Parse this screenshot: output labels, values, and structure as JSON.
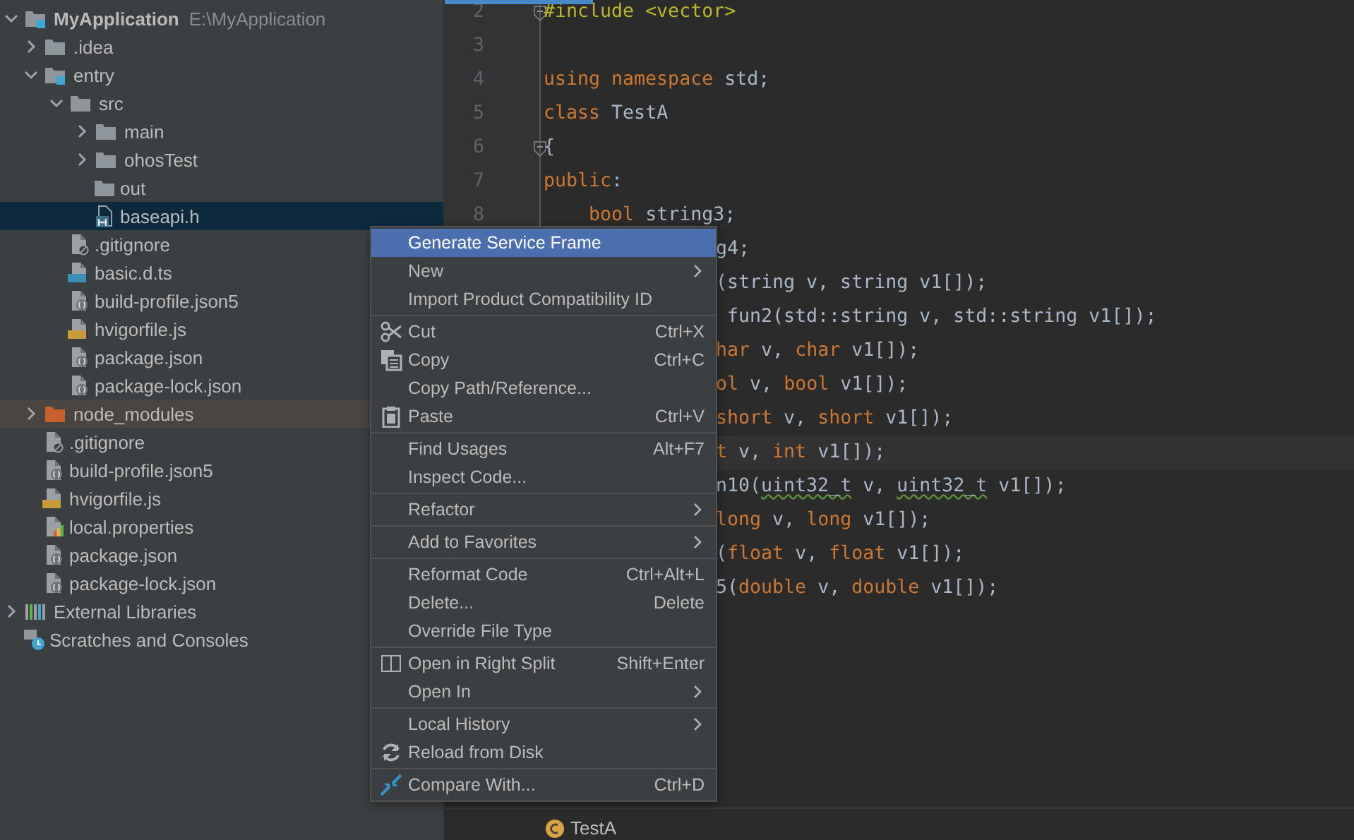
{
  "project_tree": [
    {
      "label": "MyApplication",
      "path": "E:\\MyApplication",
      "kind": "module-folder",
      "expanded": true,
      "selected": false,
      "children": [
        {
          "label": ".idea",
          "kind": "folder",
          "expanded": false,
          "selected": false
        },
        {
          "label": "entry",
          "kind": "module-folder",
          "expanded": true,
          "selected": false,
          "children": [
            {
              "label": "src",
              "kind": "folder",
              "expanded": true,
              "selected": false,
              "children": [
                {
                  "label": "main",
                  "kind": "folder",
                  "expanded": false,
                  "selected": false
                },
                {
                  "label": "ohosTest",
                  "kind": "folder",
                  "expanded": false,
                  "selected": false
                },
                {
                  "label": "out",
                  "kind": "folder",
                  "selected": false
                },
                {
                  "label": "baseapi.h",
                  "kind": "header",
                  "selected": true
                }
              ]
            },
            {
              "label": ".gitignore",
              "kind": "ignore",
              "selected": false
            },
            {
              "label": "basic.d.ts",
              "kind": "ts",
              "selected": false
            },
            {
              "label": "build-profile.json5",
              "kind": "json",
              "selected": false
            },
            {
              "label": "hvigorfile.js",
              "kind": "js",
              "selected": false
            },
            {
              "label": "package.json",
              "kind": "json",
              "selected": false
            },
            {
              "label": "package-lock.json",
              "kind": "json",
              "selected": false
            }
          ]
        },
        {
          "label": "node_modules",
          "kind": "excluded-folder",
          "expanded": false,
          "selected": false
        },
        {
          "label": ".gitignore",
          "kind": "ignore",
          "selected": false
        },
        {
          "label": "build-profile.json5",
          "kind": "json",
          "selected": false
        },
        {
          "label": "hvigorfile.js",
          "kind": "js",
          "selected": false
        },
        {
          "label": "local.properties",
          "kind": "properties",
          "selected": false
        },
        {
          "label": "package.json",
          "kind": "json",
          "selected": false
        },
        {
          "label": "package-lock.json",
          "kind": "json",
          "selected": false
        }
      ]
    },
    {
      "label": "External Libraries",
      "kind": "libraries",
      "expanded": false,
      "selected": false
    },
    {
      "label": "Scratches and Consoles",
      "kind": "scratches",
      "selected": false
    }
  ],
  "editor": {
    "lines": [
      {
        "number": "2",
        "kind": "full",
        "fold": true,
        "tokens": [
          {
            "text": "#include <vector>",
            "kind": "macro"
          }
        ]
      },
      {
        "number": "3",
        "kind": "full"
      },
      {
        "number": "4",
        "kind": "full",
        "tokens": [
          {
            "text": "using namespace ",
            "kind": "keyword"
          },
          {
            "text": "std;",
            "kind": "plain"
          }
        ]
      },
      {
        "number": "5",
        "kind": "full",
        "tokens": [
          {
            "text": "class ",
            "kind": "keyword"
          },
          {
            "text": "TestA",
            "kind": "plain"
          }
        ]
      },
      {
        "number": "6",
        "kind": "full",
        "fold": true,
        "tokens": [
          {
            "text": "{",
            "kind": "plain"
          }
        ]
      },
      {
        "number": "7",
        "kind": "full",
        "tokens": [
          {
            "text": "public",
            "kind": "keyword"
          },
          {
            "text": ":",
            "kind": "plain"
          }
        ]
      },
      {
        "number": "8",
        "kind": "full",
        "tokens": [
          {
            "text": "    bool ",
            "kind": "keyword"
          },
          {
            "text": "string3;",
            "kind": "plain"
          }
        ]
      },
      {
        "kind": "partial",
        "tokens": [
          {
            "text": "g4;",
            "kind": "plain"
          }
        ]
      },
      {
        "kind": "partial",
        "tokens": [
          {
            "text": "(string v, string v1[]);",
            "kind": "plain"
          }
        ]
      },
      {
        "kind": "partial",
        "tokens": [
          {
            "text": " fun2(std::string v, std::string v1[]);",
            "kind": "plain"
          }
        ]
      },
      {
        "kind": "partial",
        "tokens": [
          {
            "text": "har ",
            "kind": "keyword"
          },
          {
            "text": "v, ",
            "kind": "plain"
          },
          {
            "text": "char ",
            "kind": "keyword"
          },
          {
            "text": "v1[]);",
            "kind": "plain"
          }
        ]
      },
      {
        "kind": "partial",
        "tokens": [
          {
            "text": "ol ",
            "kind": "keyword"
          },
          {
            "text": "v, ",
            "kind": "plain"
          },
          {
            "text": "bool ",
            "kind": "keyword"
          },
          {
            "text": "v1[]);",
            "kind": "plain"
          }
        ]
      },
      {
        "kind": "partial",
        "tokens": [
          {
            "text": "short ",
            "kind": "keyword"
          },
          {
            "text": "v, ",
            "kind": "plain"
          },
          {
            "text": "short ",
            "kind": "keyword"
          },
          {
            "text": "v1[]);",
            "kind": "plain"
          }
        ]
      },
      {
        "kind": "partial",
        "current": true,
        "tokens": [
          {
            "text": "t ",
            "kind": "keyword"
          },
          {
            "text": "v, ",
            "kind": "plain"
          },
          {
            "text": "int ",
            "kind": "keyword"
          },
          {
            "text": "v1[]);",
            "kind": "plain"
          }
        ]
      },
      {
        "kind": "partial",
        "tokens": [
          {
            "text": "n10(",
            "kind": "plain"
          },
          {
            "text": "uint32_t",
            "kind": "warning"
          },
          {
            "text": " v, ",
            "kind": "plain"
          },
          {
            "text": "uint32_t",
            "kind": "warning"
          },
          {
            "text": " v1[]);",
            "kind": "plain"
          }
        ]
      },
      {
        "kind": "partial",
        "tokens": [
          {
            "text": "long ",
            "kind": "keyword"
          },
          {
            "text": "v, ",
            "kind": "plain"
          },
          {
            "text": "long ",
            "kind": "keyword"
          },
          {
            "text": "v1[]);",
            "kind": "plain"
          }
        ]
      },
      {
        "kind": "partial",
        "tokens": [
          {
            "text": "(",
            "kind": "plain"
          },
          {
            "text": "float ",
            "kind": "keyword"
          },
          {
            "text": "v, ",
            "kind": "plain"
          },
          {
            "text": "float ",
            "kind": "keyword"
          },
          {
            "text": "v1[]);",
            "kind": "plain"
          }
        ]
      },
      {
        "kind": "partial",
        "tokens": [
          {
            "text": "5(",
            "kind": "plain"
          },
          {
            "text": "double ",
            "kind": "keyword"
          },
          {
            "text": "v, ",
            "kind": "plain"
          },
          {
            "text": "double ",
            "kind": "keyword"
          },
          {
            "text": "v1[]);",
            "kind": "plain"
          }
        ]
      }
    ],
    "breadcrumb": "TestA"
  },
  "context_menu": [
    {
      "kind": "item",
      "label": "Generate Service Frame",
      "selected": true
    },
    {
      "kind": "item",
      "label": "New",
      "submenu": true,
      "selected": false
    },
    {
      "kind": "item",
      "label": "Import Product Compatibility ID",
      "selected": false
    },
    {
      "kind": "separator"
    },
    {
      "kind": "item",
      "label": "Cut",
      "shortcut": "Ctrl+X",
      "selected": false
    },
    {
      "kind": "item",
      "label": "Copy",
      "shortcut": "Ctrl+C",
      "selected": false
    },
    {
      "kind": "item",
      "label": "Copy Path/Reference...",
      "selected": false
    },
    {
      "kind": "item",
      "label": "Paste",
      "shortcut": "Ctrl+V",
      "selected": false
    },
    {
      "kind": "separator"
    },
    {
      "kind": "item",
      "label": "Find Usages",
      "shortcut": "Alt+F7",
      "selected": false
    },
    {
      "kind": "item",
      "label": "Inspect Code...",
      "selected": false
    },
    {
      "kind": "separator"
    },
    {
      "kind": "item",
      "label": "Refactor",
      "submenu": true,
      "selected": false
    },
    {
      "kind": "separator"
    },
    {
      "kind": "item",
      "label": "Add to Favorites",
      "submenu": true,
      "selected": false
    },
    {
      "kind": "separator"
    },
    {
      "kind": "item",
      "label": "Reformat Code",
      "shortcut": "Ctrl+Alt+L",
      "selected": false
    },
    {
      "kind": "item",
      "label": "Delete...",
      "shortcut": "Delete",
      "selected": false
    },
    {
      "kind": "item",
      "label": "Override File Type",
      "selected": false
    },
    {
      "kind": "separator"
    },
    {
      "kind": "item",
      "label": "Open in Right Split",
      "shortcut": "Shift+Enter",
      "selected": false
    },
    {
      "kind": "item",
      "label": "Open In",
      "submenu": true,
      "selected": false
    },
    {
      "kind": "separator"
    },
    {
      "kind": "item",
      "label": "Local History",
      "submenu": true,
      "selected": false
    },
    {
      "kind": "item",
      "label": "Reload from Disk",
      "selected": false
    },
    {
      "kind": "separator"
    },
    {
      "kind": "item",
      "label": "Compare With...",
      "shortcut": "Ctrl+D",
      "selected": false
    }
  ]
}
